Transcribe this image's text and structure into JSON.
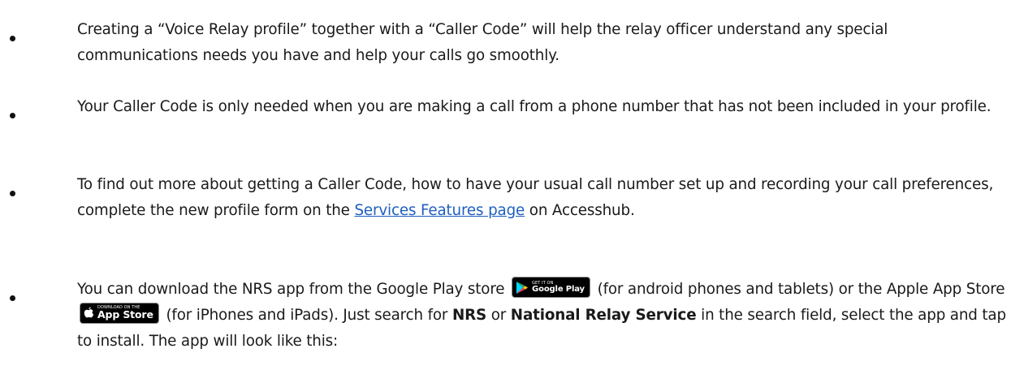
{
  "bullets": [
    {
      "text": "Creating a “Voice Relay profile” together with a “Caller Code” will help the relay officer understand any special communications needs you have and help your calls go smoothly."
    },
    {
      "text": "Your Caller Code is only needed when you are making a call from a phone number that has not been included in your profile."
    },
    {
      "text_before": "To find out more about getting a Caller Code, how to have your usual call number set up and recording your call preferences, complete the new profile form on the ",
      "link": "Services Features page",
      "text_after": " on Accesshub."
    },
    {
      "t1": "You can download the NRS app from the Google Play store ",
      "t2": " (for android phones and tablets) or the Apple App Store ",
      "t3": " (for iPhones and iPads). Just search for ",
      "bold1": "NRS",
      "t4": " or ",
      "bold2": "National Relay Service",
      "t5": " in the search field, select the app and tap to install. The app will look like this:"
    }
  ],
  "badges": {
    "google": {
      "small": "GET IT ON",
      "big": "Google Play",
      "icon": "google-play-icon"
    },
    "apple": {
      "small": "Download on the",
      "big": "App Store",
      "icon": "apple-icon"
    }
  },
  "colors": {
    "link": "#1f5fbf",
    "text": "#1a1a1a"
  }
}
